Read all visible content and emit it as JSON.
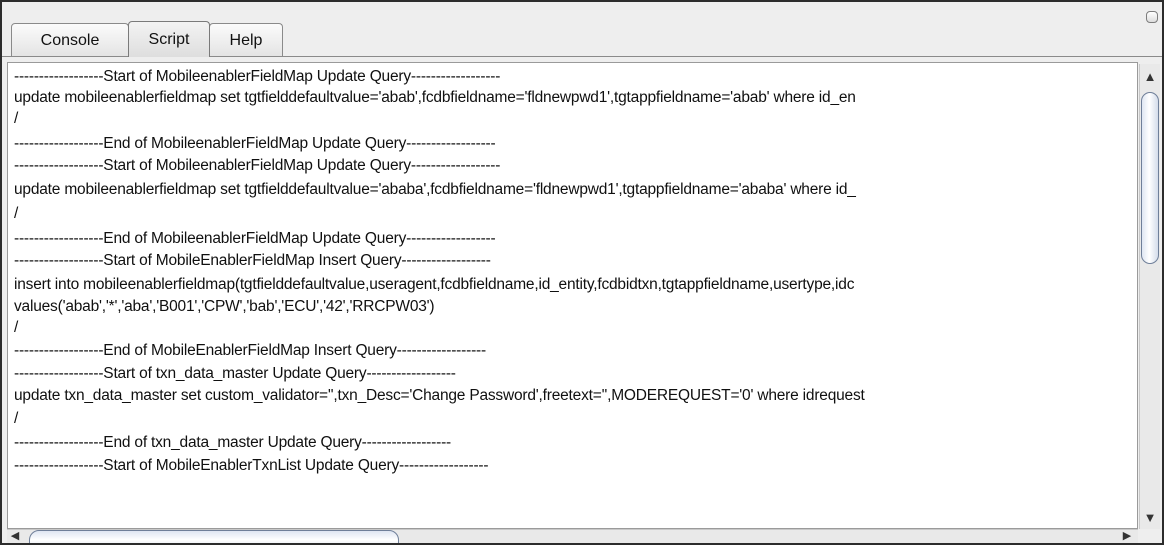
{
  "tabs": [
    {
      "label": "Console",
      "selected": false
    },
    {
      "label": "Script",
      "selected": true
    },
    {
      "label": "Help",
      "selected": false
    }
  ],
  "script_lines": [
    "------------------Start of MobileenablerFieldMap Update Query------------------",
    "update mobileenablerfieldmap set tgtfielddefaultvalue='abab',fcdbfieldname='fldnewpwd1',tgtappfieldname='abab' where id_en",
    "/",
    "------------------End of MobileenablerFieldMap Update Query------------------",
    "------------------Start of MobileenablerFieldMap Update Query------------------",
    "update mobileenablerfieldmap set tgtfielddefaultvalue='ababa',fcdbfieldname='fldnewpwd1',tgtappfieldname='ababa' where id_",
    "/",
    "------------------End of MobileenablerFieldMap Update Query------------------",
    "------------------Start of MobileEnablerFieldMap Insert Query------------------",
    "insert into mobileenablerfieldmap(tgtfielddefaultvalue,useragent,fcdbfieldname,id_entity,fcdbidtxn,tgtappfieldname,usertype,idc",
    "values('abab','*','aba','B001','CPW','bab','ECU','42','RRCPW03')",
    "/",
    "------------------End of MobileEnablerFieldMap Insert Query------------------",
    "------------------Start of txn_data_master Update Query------------------",
    "update txn_data_master set custom_validator='',txn_Desc='Change Password',freetext='',MODEREQUEST='0' where idrequest",
    "/",
    "------------------End of txn_data_master Update Query------------------",
    "------------------Start of MobileEnablerTxnList Update Query------------------"
  ],
  "colors": {
    "accent_thumb_border": "#6f7f99",
    "panel_bg": "#eeeeee",
    "text": "#101010"
  },
  "icons": {
    "scroll_up": "triangle-up-icon",
    "scroll_down": "triangle-down-icon",
    "scroll_left": "triangle-left-icon",
    "scroll_right": "triangle-right-icon",
    "window_knob": "rounded-square-icon"
  }
}
